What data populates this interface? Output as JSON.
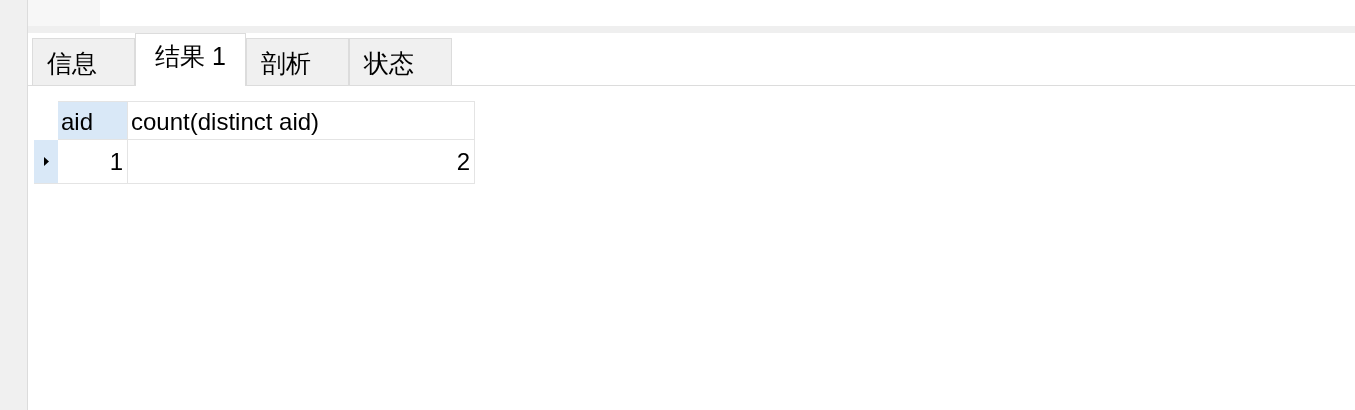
{
  "tabs": [
    {
      "label": "信息",
      "selected": false
    },
    {
      "label": "结果 1",
      "selected": true
    },
    {
      "label": "剖析",
      "selected": false
    },
    {
      "label": "状态",
      "selected": false
    }
  ],
  "table": {
    "columns": [
      {
        "label": "aid",
        "selected": true
      },
      {
        "label": "count(distinct aid)",
        "selected": false
      }
    ],
    "rows": [
      {
        "selected": true,
        "cells": [
          "1",
          "2"
        ]
      }
    ]
  }
}
